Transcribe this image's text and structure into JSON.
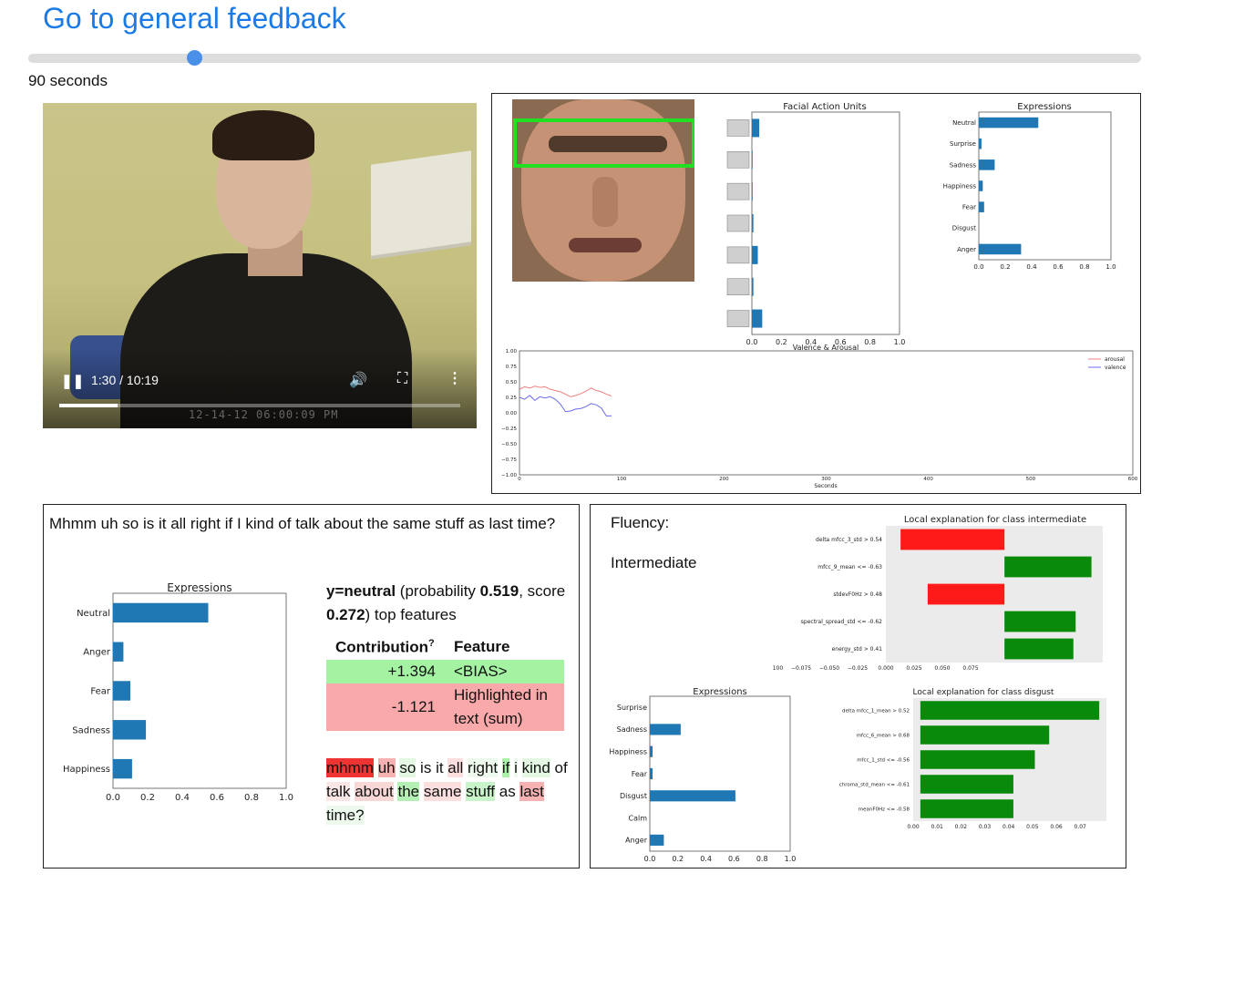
{
  "header": {
    "feedback_link": "Go to general feedback"
  },
  "timeline": {
    "seconds_label": "90 seconds",
    "progress_fraction": 0.15
  },
  "video": {
    "time": "1:30 / 10:19",
    "timestamp_overlay": "12-14-12  06:00:09 PM",
    "progress_fraction": 0.145
  },
  "analysis": {
    "facial_action_units": {
      "title": "Facial Action Units",
      "ticks": [
        "0.0",
        "0.2",
        "0.4",
        "0.6",
        "0.8",
        "1.0"
      ],
      "values": [
        0.05,
        0.0,
        0.0,
        0.01,
        0.04,
        0.01,
        0.07
      ]
    },
    "expressions": {
      "title": "Expressions",
      "categories": [
        "Neutral",
        "Surprise",
        "Sadness",
        "Happiness",
        "Fear",
        "Disgust",
        "Anger"
      ],
      "values": [
        0.45,
        0.02,
        0.12,
        0.03,
        0.04,
        0.0,
        0.32
      ],
      "ticks": [
        "0.0",
        "0.2",
        "0.4",
        "0.6",
        "0.8",
        "1.0"
      ]
    },
    "valence_arousal": {
      "title": "Valence & Arousal",
      "xlabel": "Seconds",
      "yticks": [
        "1.00",
        "0.75",
        "0.50",
        "0.25",
        "0.00",
        "−0.25",
        "−0.50",
        "−0.75",
        "−1.00"
      ],
      "xticks": [
        "0",
        "100",
        "200",
        "300",
        "400",
        "500",
        "600"
      ],
      "legend": [
        "arousal",
        "valence"
      ],
      "colors": {
        "arousal": "#f08080",
        "valence": "#6b6bf0"
      },
      "arousal_points": [
        [
          0,
          0.38
        ],
        [
          5,
          0.42
        ],
        [
          10,
          0.4
        ],
        [
          15,
          0.43
        ],
        [
          20,
          0.41
        ],
        [
          25,
          0.42
        ],
        [
          30,
          0.38
        ],
        [
          35,
          0.36
        ],
        [
          40,
          0.34
        ],
        [
          45,
          0.3
        ],
        [
          50,
          0.26
        ],
        [
          55,
          0.28
        ],
        [
          60,
          0.31
        ],
        [
          65,
          0.35
        ],
        [
          70,
          0.4
        ],
        [
          75,
          0.36
        ],
        [
          80,
          0.34
        ],
        [
          85,
          0.3
        ],
        [
          90,
          0.27
        ]
      ],
      "valence_points": [
        [
          0,
          0.25
        ],
        [
          5,
          0.22
        ],
        [
          10,
          0.28
        ],
        [
          15,
          0.2
        ],
        [
          20,
          0.26
        ],
        [
          25,
          0.24
        ],
        [
          30,
          0.26
        ],
        [
          35,
          0.22
        ],
        [
          40,
          0.14
        ],
        [
          45,
          0.02
        ],
        [
          50,
          0.03
        ],
        [
          55,
          0.06
        ],
        [
          60,
          0.07
        ],
        [
          65,
          0.1
        ],
        [
          70,
          0.15
        ],
        [
          75,
          0.13
        ],
        [
          80,
          0.08
        ],
        [
          85,
          -0.05
        ],
        [
          90,
          -0.05
        ]
      ]
    }
  },
  "transcript": {
    "sentence": "Mhmm uh so is it all right if I kind of talk about the same stuff as last time?",
    "expressions_chart": {
      "title": "Expressions",
      "categories": [
        "Neutral",
        "Anger",
        "Fear",
        "Sadness",
        "Happiness"
      ],
      "values": [
        0.55,
        0.06,
        0.1,
        0.19,
        0.11
      ],
      "ticks": [
        "0.0",
        "0.2",
        "0.4",
        "0.6",
        "0.8",
        "1.0"
      ]
    },
    "prediction": {
      "label": "y=neutral",
      "text1": " (probability ",
      "probability": "0.519",
      "text2": ", score ",
      "score": "0.272",
      "text3": ") top features"
    },
    "table": {
      "col_contribution": "Contribution",
      "col_sup": "?",
      "col_feature": "Feature",
      "rows": [
        {
          "contribution": "+1.394",
          "feature": "<BIAS>"
        },
        {
          "contribution": "-1.121",
          "feature": "Highlighted in text (sum)"
        }
      ]
    },
    "highlighted_words": [
      {
        "text": "mhmm",
        "color": "#ee3333"
      },
      {
        "text": "uh",
        "color": "#f6b2b2"
      },
      {
        "text": "so",
        "color": "#e3f7e3"
      },
      {
        "text": "is",
        "color": ""
      },
      {
        "text": "it",
        "color": ""
      },
      {
        "text": "all",
        "color": "#fbdede"
      },
      {
        "text": "right",
        "color": "#eef9ee"
      },
      {
        "text": "if",
        "color": "#a9f0a9"
      },
      {
        "text": "i",
        "color": "#eef9ee"
      },
      {
        "text": "kind",
        "color": "#e3f7e3"
      },
      {
        "text": "of",
        "color": ""
      },
      {
        "text": "talk",
        "color": "#fbe6e6"
      },
      {
        "text": "about",
        "color": "#f9d7d7"
      },
      {
        "text": "the",
        "color": "#b4f0b4"
      },
      {
        "text": "same",
        "color": "#fbdede"
      },
      {
        "text": "stuff",
        "color": "#c9f4c9"
      },
      {
        "text": "as",
        "color": ""
      },
      {
        "text": "last",
        "color": "#f6b2b2"
      },
      {
        "text": "time?",
        "color": "#eef9ee"
      }
    ]
  },
  "fluency": {
    "title": "Fluency:",
    "value": "Intermediate",
    "lime_intermediate": {
      "title": "Local explanation for class intermediate",
      "features": [
        "delta mfcc_3_std > 0.54",
        "mfcc_9_mean <= -0.63",
        "stdevF0Hz > 0.48",
        "spectral_spread_std <= -0.62",
        "energy_std > 0.41"
      ],
      "values": [
        -0.092,
        0.077,
        -0.068,
        0.063,
        0.061
      ],
      "ticks": [
        "−0.100",
        "−0.075",
        "−0.050",
        "−0.025",
        "0.000",
        "0.025",
        "0.050",
        "0.075"
      ],
      "colors": {
        "neg": "#ff1a1a",
        "pos": "#0a8a0a"
      }
    },
    "lime_disgust": {
      "title": "Local explanation for class disgust",
      "features": [
        "delta mfcc_1_mean > 0.52",
        "mfcc_6_mean > 0.68",
        "mfcc_1_std <= -0.56",
        "chroma_std_mean <= -0.61",
        "meanF0Hz <= -0.58"
      ],
      "values": [
        0.075,
        0.054,
        0.048,
        0.039,
        0.039
      ],
      "ticks": [
        "0.00",
        "0.01",
        "0.02",
        "0.03",
        "0.04",
        "0.05",
        "0.06",
        "0.07"
      ]
    },
    "expressions_chart": {
      "title": "Expressions",
      "categories": [
        "Surprise",
        "Sadness",
        "Happiness",
        "Fear",
        "Disgust",
        "Calm",
        "Anger"
      ],
      "values": [
        0.0,
        0.22,
        0.02,
        0.02,
        0.61,
        0.0,
        0.1
      ],
      "ticks": [
        "0.0",
        "0.2",
        "0.4",
        "0.6",
        "0.8",
        "1.0"
      ]
    }
  }
}
